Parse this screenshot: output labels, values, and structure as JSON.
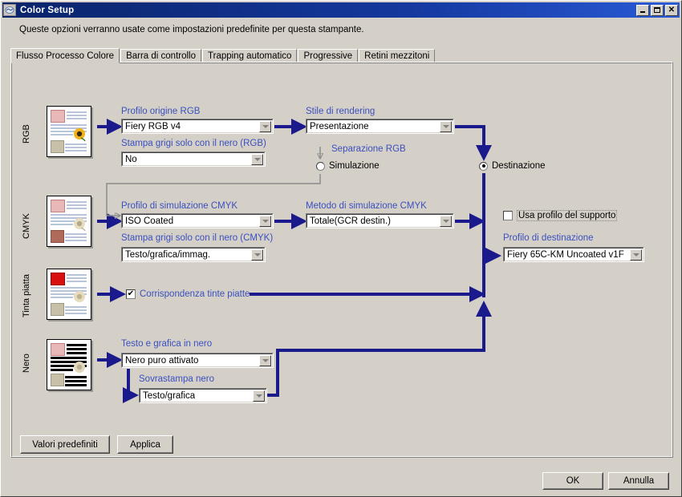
{
  "window": {
    "title": "Color Setup",
    "icon": "fiery-logo-icon",
    "minimize_label": "Minimize",
    "maximize_label": "Maximize",
    "close_label": "Close"
  },
  "description": "Queste opzioni verranno usate come impostazioni predefinite per questa stampante.",
  "tabs": [
    {
      "label": "Flusso Processo Colore",
      "active": true
    },
    {
      "label": "Barra di controllo",
      "active": false
    },
    {
      "label": "Trapping automatico",
      "active": false
    },
    {
      "label": "Progressive",
      "active": false
    },
    {
      "label": "Retini mezzitoni",
      "active": false
    }
  ],
  "sections": {
    "rgb": {
      "row_label": "RGB",
      "profile_label": "Profilo origine RGB",
      "profile_value": "Fiery RGB v4",
      "gray_label": "Stampa grigi solo con il nero (RGB)",
      "gray_value": "No",
      "rendering_label": "Stile di rendering",
      "rendering_value": "Presentazione",
      "separation_label": "Separazione RGB",
      "separation_option_simulation": "Simulazione",
      "separation_option_destination": "Destinazione",
      "separation_selected": "Destinazione"
    },
    "cmyk": {
      "row_label": "CMYK",
      "profile_label": "Profilo di simulazione CMYK",
      "profile_value": "ISO Coated",
      "gray_label": "Stampa grigi solo con il nero (CMYK)",
      "gray_value": "Testo/grafica/immag.",
      "method_label": "Metodo di simulazione CMYK",
      "method_value": "Totale(GCR destin.)"
    },
    "spot": {
      "row_label": "Tinta piatta",
      "checkbox_label": "Corrispondenza tinte piatte",
      "checkbox_checked": true,
      "checkbox_glyph": "✔"
    },
    "black": {
      "row_label": "Nero",
      "text_graphics_label": "Testo e grafica in nero",
      "text_graphics_value": "Nero puro attivato",
      "overprint_label": "Sovrastampa nero",
      "overprint_value": "Testo/grafica"
    },
    "output": {
      "use_media_profile_label": "Usa profilo del supporto",
      "use_media_profile_checked": false,
      "destination_profile_label": "Profilo di destinazione",
      "destination_profile_value": "Fiery 65C-KM Uncoated v1F"
    }
  },
  "buttons": {
    "defaults": "Valori predefiniti",
    "apply": "Applica",
    "ok": "OK",
    "cancel": "Annulla"
  },
  "colors": {
    "titlebar_start": "#0a246a",
    "titlebar_end": "#2a5ad6",
    "window_face": "#d4d0c8",
    "flow_arrow": "#1a1a8c",
    "label_blue": "#3b4fbf",
    "feedback_line": "#8a8a8a"
  }
}
